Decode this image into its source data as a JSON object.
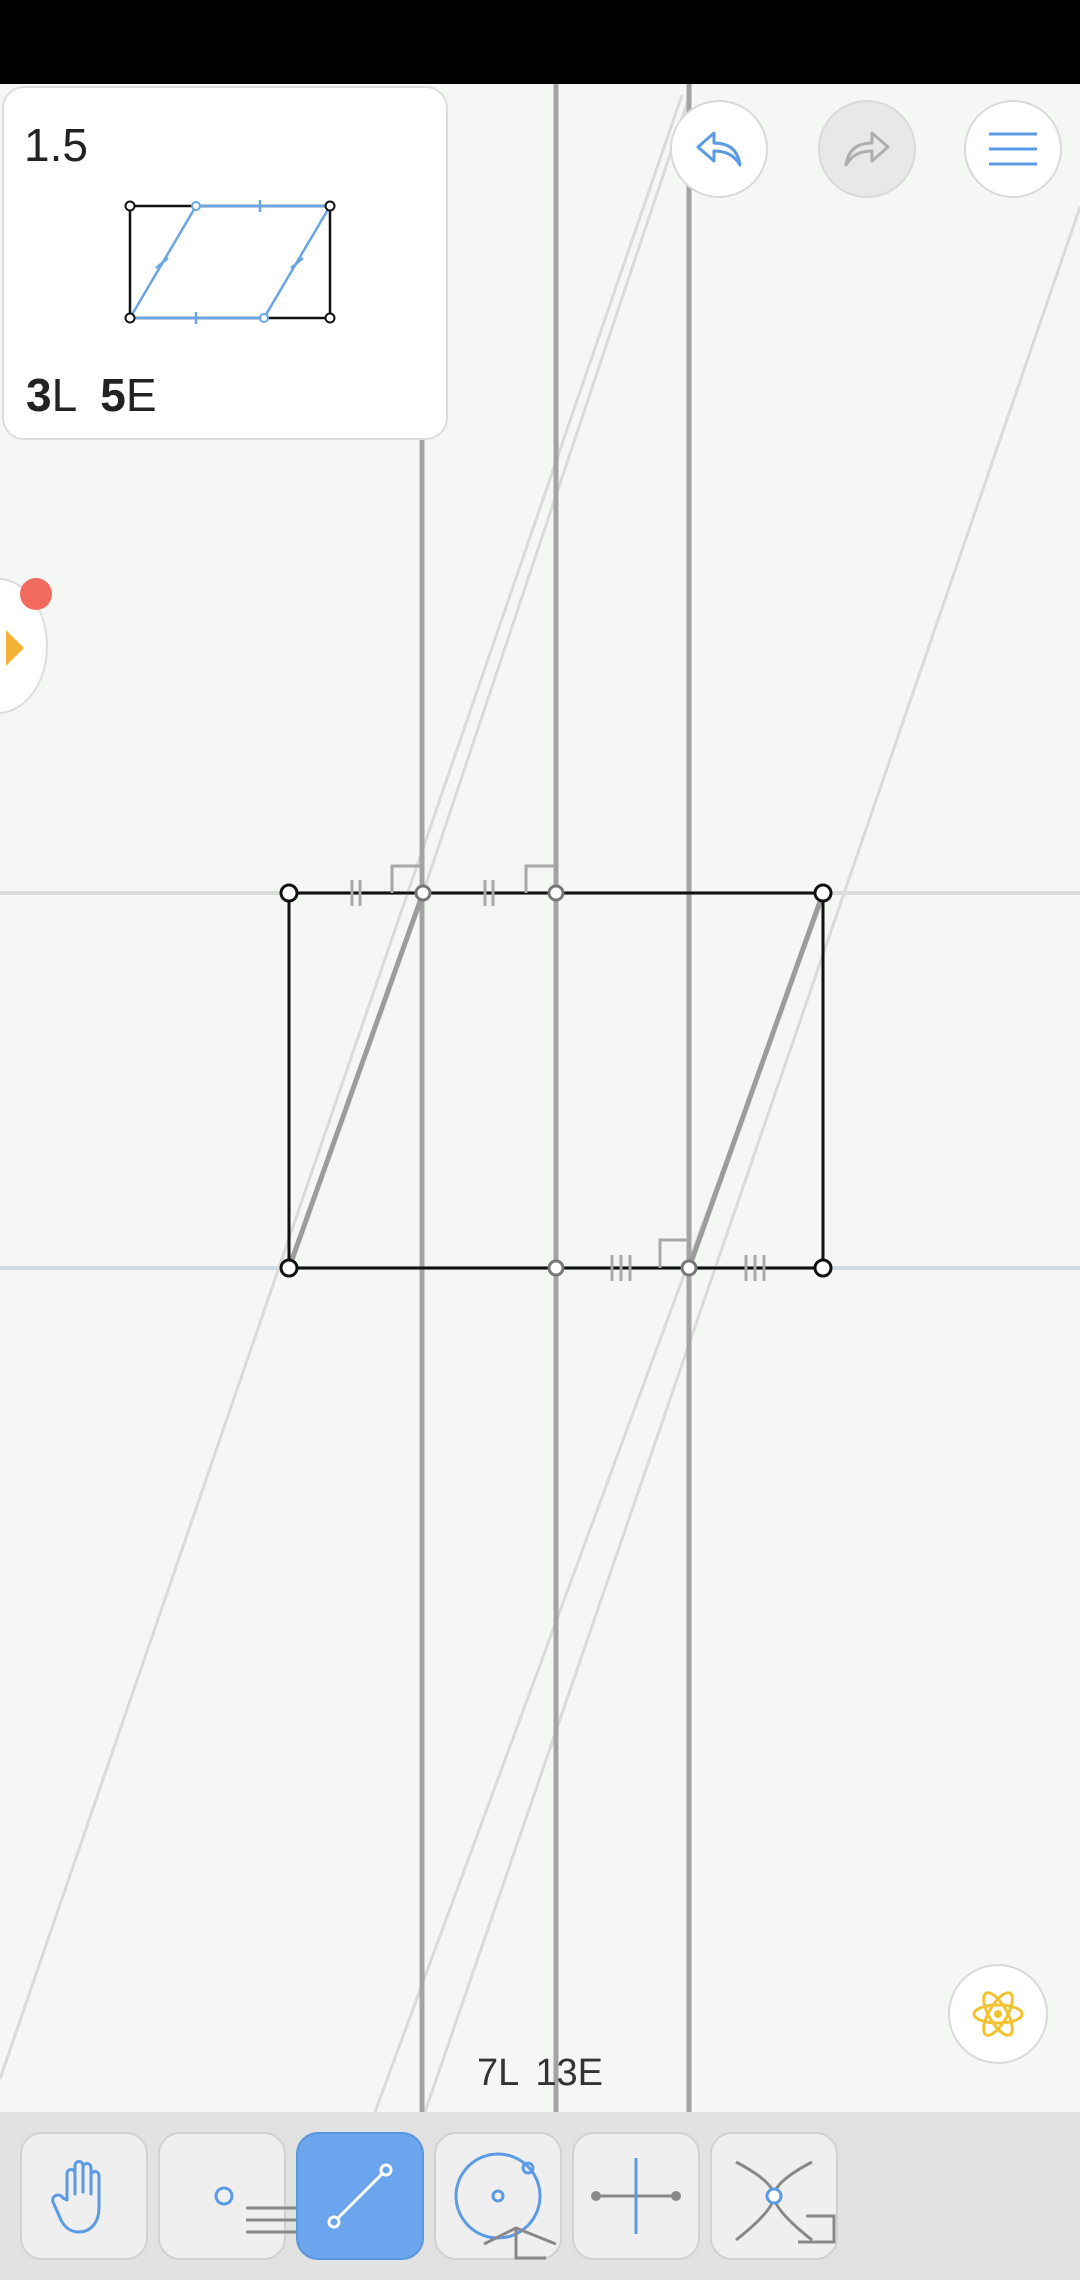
{
  "level": {
    "number": "1.5",
    "lines_goal": "3",
    "lines_unit": "L",
    "euclid_goal": "5",
    "euclid_unit": "E"
  },
  "moves": {
    "lines": "7L",
    "euclid": "13E"
  },
  "colors": {
    "accent": "#5b9be6",
    "hint": "#f2c230",
    "notify": "#f26a5e",
    "toggle_arrow": "#f5b335"
  },
  "icons": {
    "undo": "undo-arrow-icon",
    "redo": "redo-arrow-icon",
    "menu": "hamburger-menu-icon",
    "hint": "atom-icon",
    "side": "chevron-right-icon"
  },
  "tools": [
    {
      "name": "hand-tool",
      "icon": "hand-icon",
      "active": false
    },
    {
      "name": "point-tool",
      "icon": "point-icon",
      "active": false
    },
    {
      "name": "line-tool",
      "icon": "line-segment-icon",
      "active": true
    },
    {
      "name": "circle-tool",
      "icon": "circle-icon",
      "active": false
    },
    {
      "name": "perpendicular-bisector-tool",
      "icon": "perpendicular-bisector-icon",
      "active": false
    },
    {
      "name": "intersect-tool",
      "icon": "intersect-icon",
      "active": false
    }
  ]
}
